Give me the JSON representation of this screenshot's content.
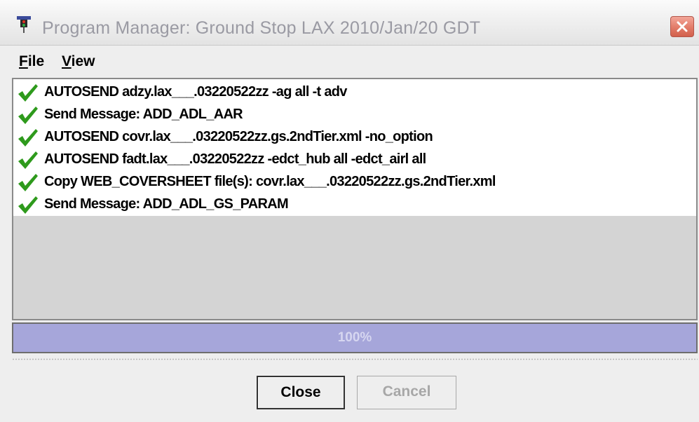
{
  "window": {
    "title": "Program Manager: Ground Stop LAX 2010/Jan/20 GDT",
    "icon": "traffic-light-icon",
    "close_icon": "close-icon"
  },
  "menu": {
    "file": {
      "mnemonic": "F",
      "rest": "ile"
    },
    "view": {
      "mnemonic": "V",
      "rest": "iew"
    }
  },
  "log": {
    "status_icon": "checkmark-icon",
    "check_color": "#2e9a1c",
    "entries": [
      "AUTOSEND adzy.lax___.03220522zz -ag all -t adv",
      "Send Message: ADD_ADL_AAR",
      "AUTOSEND covr.lax___.03220522zz.gs.2ndTier.xml -no_option",
      "AUTOSEND fadt.lax___.03220522zz  -edct_hub all -edct_airl all",
      "Copy WEB_COVERSHEET file(s): covr.lax___.03220522zz.gs.2ndTier.xml",
      "Send Message: ADD_ADL_GS_PARAM"
    ]
  },
  "progress": {
    "label": "100%",
    "value": 1.0,
    "fill_color": "#a6a6da"
  },
  "buttons": {
    "close": "Close",
    "cancel": "Cancel",
    "cancel_enabled": false
  }
}
